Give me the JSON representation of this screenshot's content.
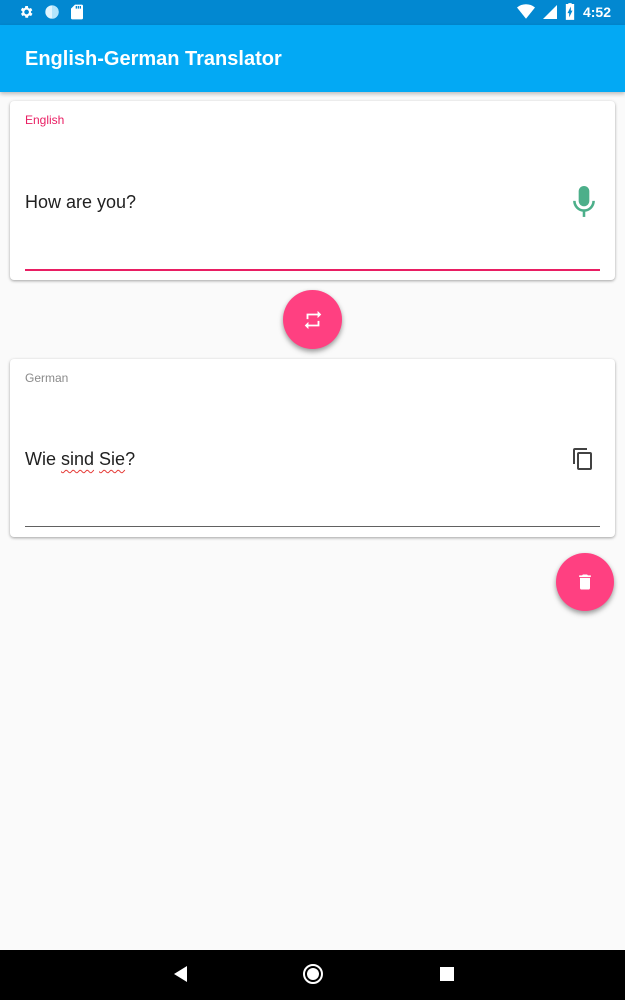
{
  "status_bar": {
    "time": "4:52",
    "icons": [
      "gear-icon",
      "circle-icon",
      "sd-card-icon",
      "wifi-icon",
      "signal-icon",
      "battery-charging-icon"
    ]
  },
  "app_bar": {
    "title": "English-German Translator"
  },
  "source": {
    "label": "English",
    "text": "How are you?",
    "action_icon": "microphone-icon"
  },
  "swap": {
    "icon": "swap-arrows-icon"
  },
  "target": {
    "label": "German",
    "text_parts": [
      "Wie ",
      "sind",
      " ",
      "Sie",
      "?"
    ],
    "action_icon": "copy-icon"
  },
  "delete": {
    "icon": "trash-icon"
  },
  "nav_bar": {
    "buttons": [
      "back-icon",
      "home-icon",
      "recents-icon"
    ]
  },
  "colors": {
    "primary": "#03a9f4",
    "primary_dark": "#0288d1",
    "accent": "#ff4081",
    "focus_line": "#e91e63",
    "mic": "#4caf8a"
  }
}
